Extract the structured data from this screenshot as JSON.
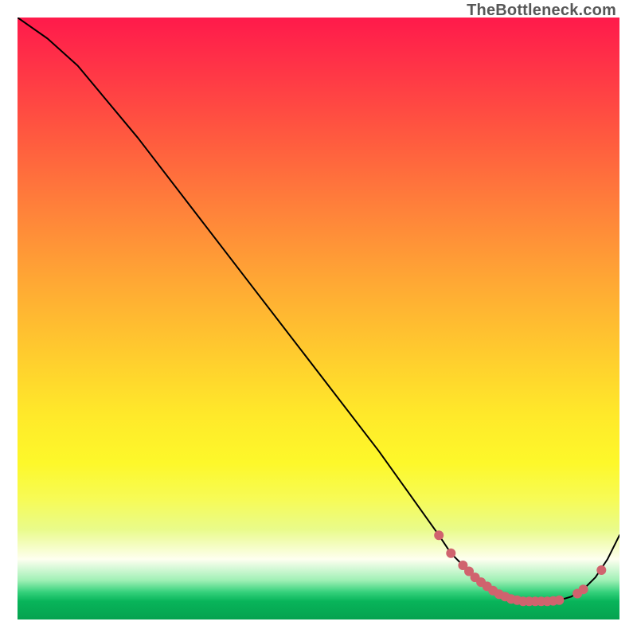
{
  "watermark": "TheBottleneck.com",
  "chart_data": {
    "type": "line",
    "title": "",
    "xlabel": "",
    "ylabel": "",
    "xlim": [
      0,
      100
    ],
    "ylim": [
      0,
      100
    ],
    "x": [
      0,
      5,
      10,
      20,
      30,
      40,
      50,
      60,
      65,
      70,
      72,
      74,
      76,
      78,
      80,
      82,
      84,
      86,
      88,
      90,
      92,
      94,
      96,
      98,
      100
    ],
    "y": [
      100,
      96.5,
      92,
      80,
      67,
      54,
      41,
      28,
      21,
      14,
      11,
      9,
      7,
      5.5,
      4.2,
      3.4,
      3,
      3,
      3,
      3.2,
      3.8,
      5,
      7,
      10,
      14
    ],
    "markers_x": [
      70,
      72,
      74,
      75,
      76,
      77,
      78,
      79,
      80,
      81,
      82,
      83,
      84,
      85,
      86,
      87,
      88,
      89,
      90,
      93,
      94,
      97
    ],
    "markers_y": [
      14,
      11,
      9,
      8,
      7,
      6.2,
      5.5,
      4.8,
      4.2,
      3.8,
      3.4,
      3.2,
      3.0,
      3.0,
      3.0,
      3.0,
      3.0,
      3.1,
      3.2,
      4.3,
      5.0,
      8.2
    ],
    "colors": {
      "top": "#ff1a4b",
      "mid": "#ffe92a",
      "bottom": "#05a24f",
      "marker": "#d0636e",
      "line": "#000000"
    }
  }
}
